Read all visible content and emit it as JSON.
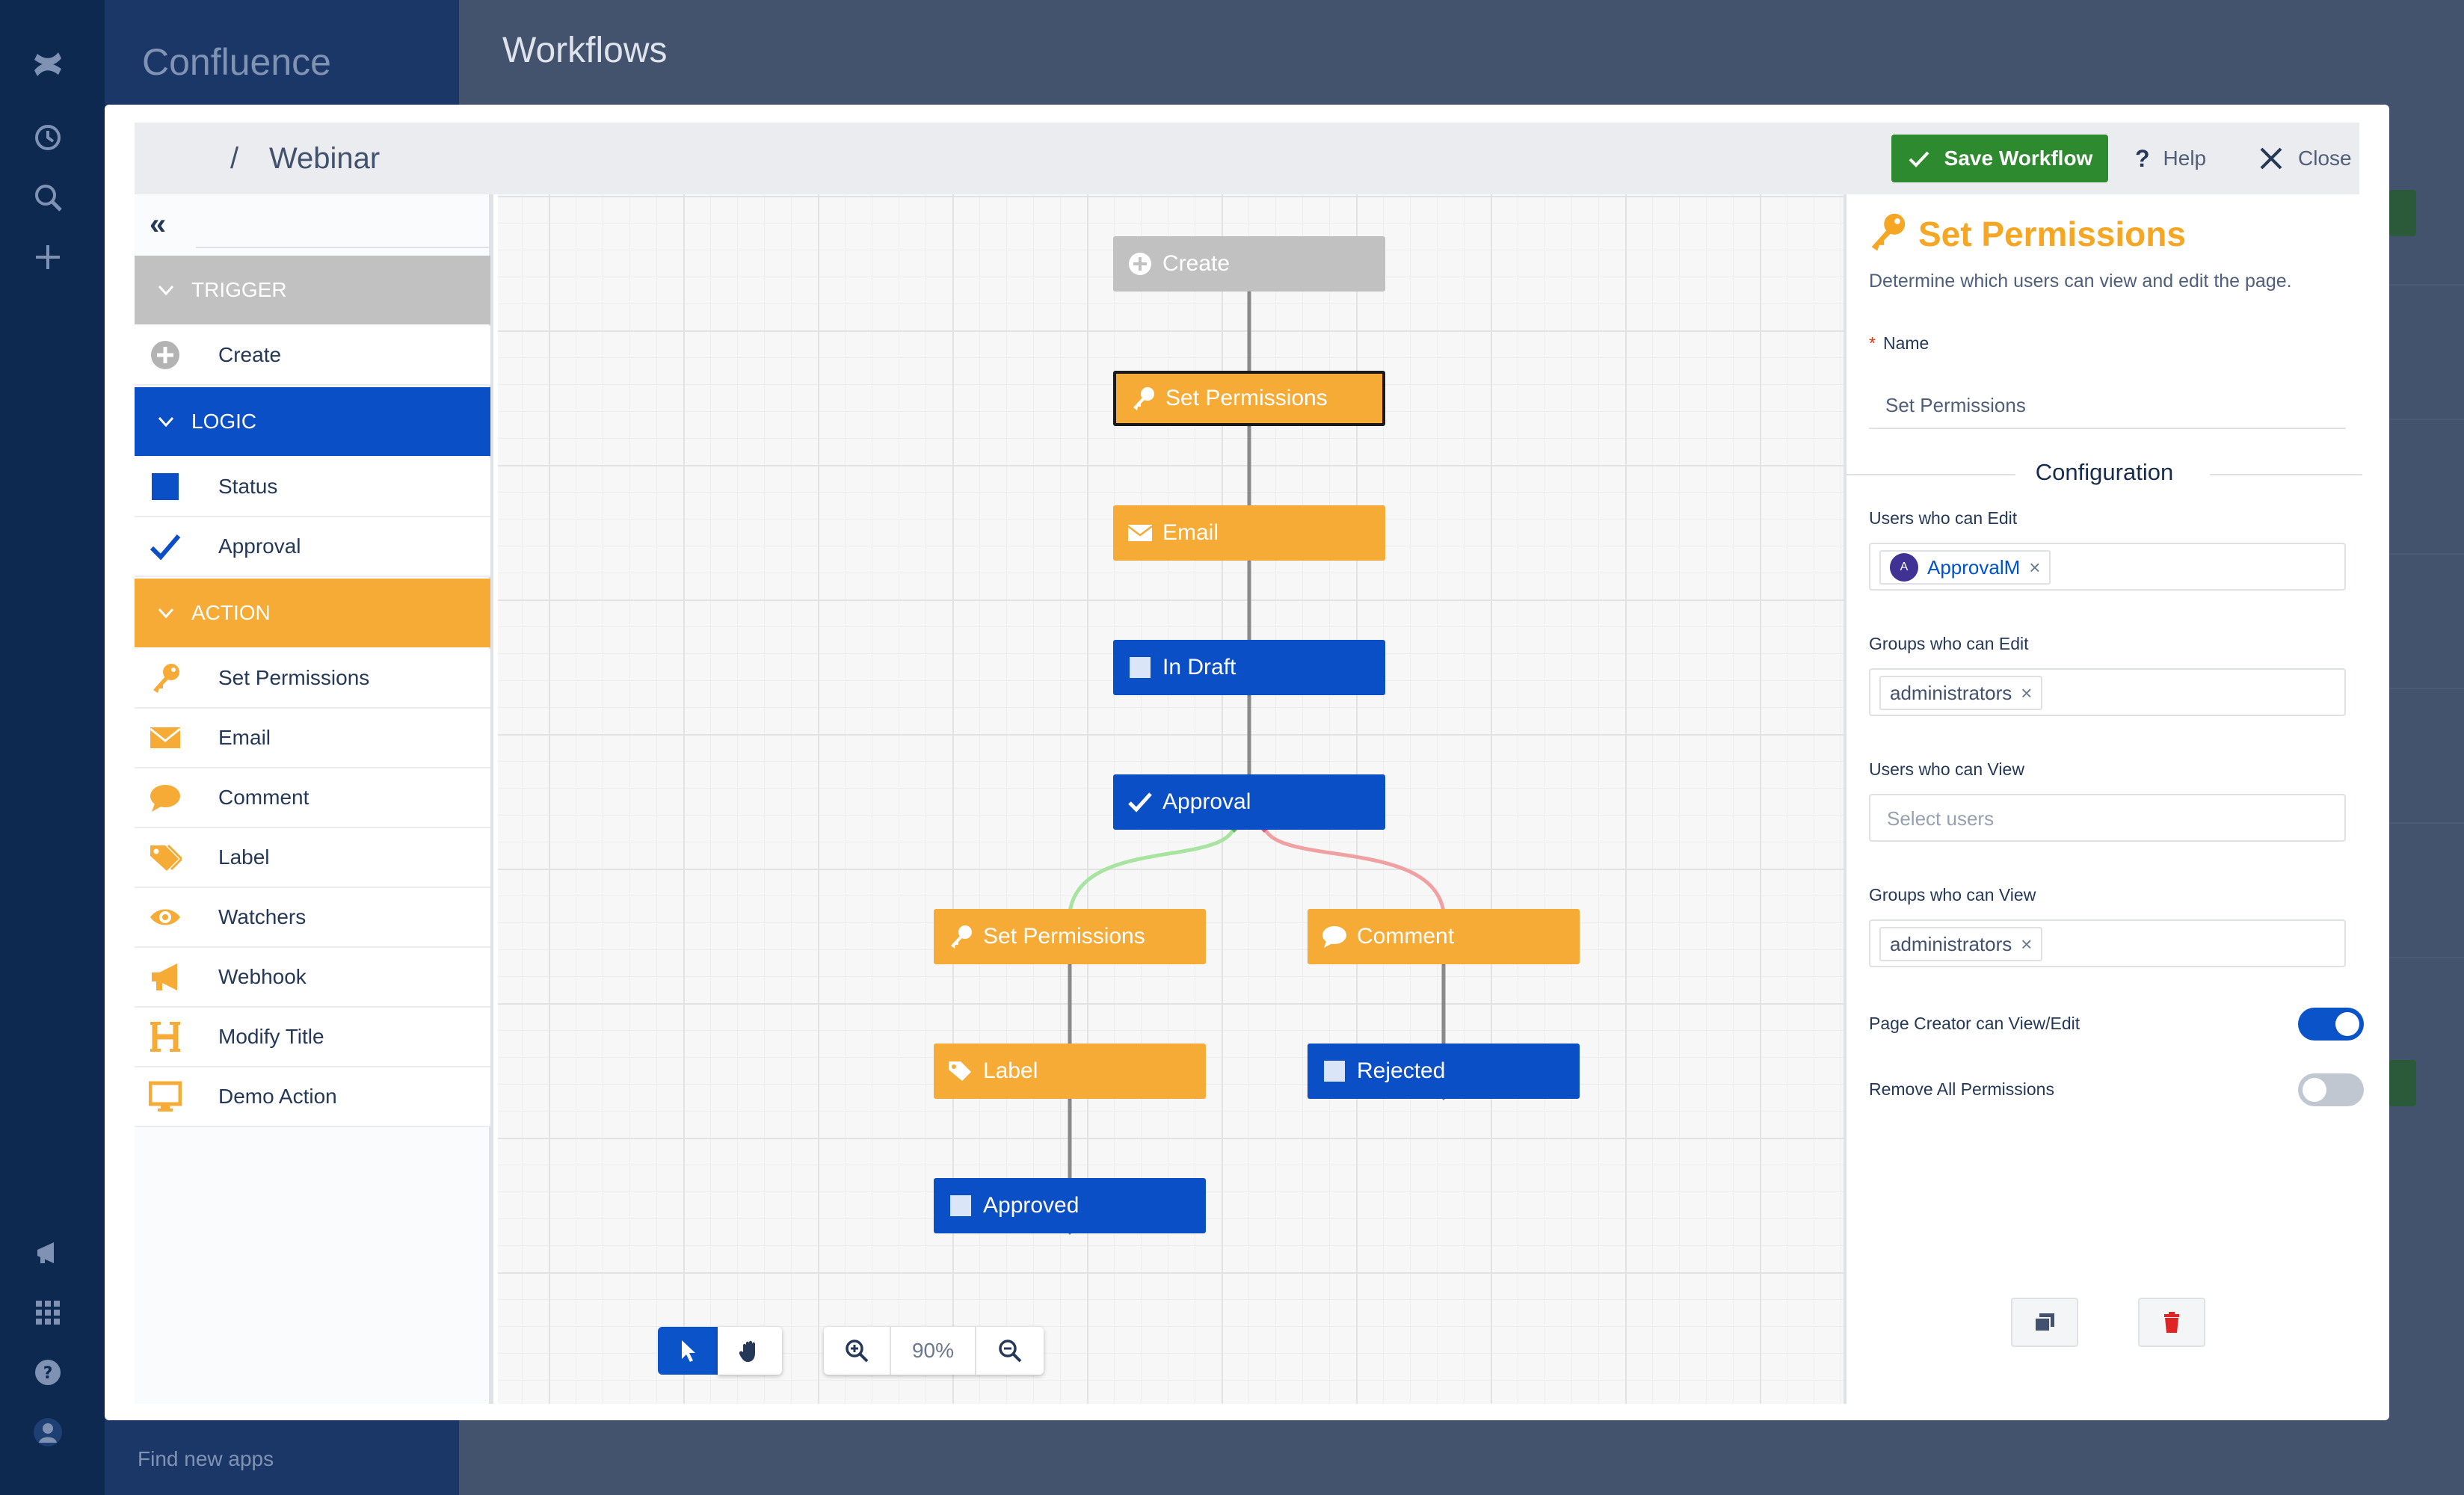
{
  "app": {
    "product_name": "Confluence",
    "page_title": "Workflows",
    "find_apps": "Find new apps"
  },
  "header": {
    "breadcrumb_separator": "/",
    "workflow_title": "Webinar",
    "save_label": "Save Workflow",
    "help_label": "Help",
    "help_glyph": "?",
    "close_label": "Close"
  },
  "palette": {
    "collapse_glyph": "«",
    "sections": [
      {
        "label": "TRIGGER",
        "color": "#c1c1c1"
      },
      {
        "label": "LOGIC",
        "color": "#0b4fc6"
      },
      {
        "label": "ACTION",
        "color": "#f5ab35"
      }
    ],
    "trigger_items": [
      {
        "label": "Create",
        "icon": "plus-circle-icon"
      }
    ],
    "logic_items": [
      {
        "label": "Status",
        "icon": "square-icon"
      },
      {
        "label": "Approval",
        "icon": "checkmark-icon"
      }
    ],
    "action_items": [
      {
        "label": "Set Permissions",
        "icon": "key-icon"
      },
      {
        "label": "Email",
        "icon": "envelope-icon"
      },
      {
        "label": "Comment",
        "icon": "speech-bubble-icon"
      },
      {
        "label": "Label",
        "icon": "tag-icon"
      },
      {
        "label": "Watchers",
        "icon": "eye-icon"
      },
      {
        "label": "Webhook",
        "icon": "megaphone-icon"
      },
      {
        "label": "Modify Title",
        "icon": "heading-icon"
      },
      {
        "label": "Demo Action",
        "icon": "monitor-icon"
      }
    ]
  },
  "canvas": {
    "nodes": [
      {
        "label": "Create",
        "kind": "trigger",
        "icon": "plus-circle-icon"
      },
      {
        "label": "Set Permissions",
        "kind": "action",
        "icon": "key-icon",
        "selected": true
      },
      {
        "label": "Email",
        "kind": "action",
        "icon": "envelope-icon"
      },
      {
        "label": "In Draft",
        "kind": "logic",
        "icon": "square-icon"
      },
      {
        "label": "Approval",
        "kind": "logic",
        "icon": "checkmark-icon"
      },
      {
        "label": "Set Permissions",
        "kind": "action",
        "icon": "key-icon"
      },
      {
        "label": "Comment",
        "kind": "action",
        "icon": "speech-bubble-icon"
      },
      {
        "label": "Label",
        "kind": "action",
        "icon": "tag-icon"
      },
      {
        "label": "Rejected",
        "kind": "logic",
        "icon": "square-icon"
      },
      {
        "label": "Approved",
        "kind": "logic",
        "icon": "square-icon"
      }
    ],
    "zoom_level": "90%",
    "connector_colors": {
      "default": "#8a8a8a",
      "approve": "#a6e4a0",
      "reject": "#f0a0a0"
    }
  },
  "properties": {
    "title": "Set Permissions",
    "title_icon": "key-icon",
    "description": "Determine which users can view and edit the page.",
    "name_label": "Name",
    "name_required_marker": "*",
    "name_value": "Set Permissions",
    "config_heading": "Configuration",
    "users_edit_label": "Users who can Edit",
    "users_edit_chip": "ApprovalM",
    "users_edit_avatar": "A",
    "groups_edit_label": "Groups who can Edit",
    "groups_edit_chip": "administrators",
    "users_view_label": "Users who can View",
    "users_view_placeholder": "Select users",
    "groups_view_label": "Groups who can View",
    "groups_view_chip": "administrators",
    "chip_remove_glyph": "×",
    "creator_toggle_label": "Page Creator can View/Edit",
    "creator_toggle_on": true,
    "remove_all_label": "Remove All Permissions",
    "remove_all_on": false
  },
  "colors": {
    "accent_blue": "#0b53c9",
    "save_green": "#2d8a2f",
    "action_orange": "#f5ab35",
    "delete_red": "#e02424"
  }
}
